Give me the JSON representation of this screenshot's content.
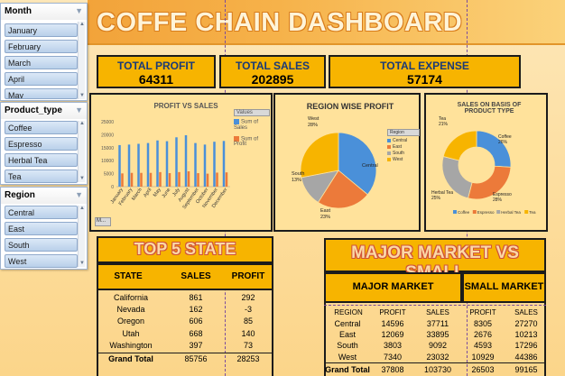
{
  "title": "COFFE CHAIN DASHBOARD",
  "slicers": {
    "month": {
      "label": "Month",
      "items": [
        "January",
        "February",
        "March",
        "April",
        "May"
      ]
    },
    "product_type": {
      "label": "Product_type",
      "items": [
        "Coffee",
        "Espresso",
        "Herbal Tea",
        "Tea"
      ]
    },
    "region": {
      "label": "Region",
      "items": [
        "Central",
        "East",
        "South",
        "West"
      ]
    }
  },
  "kpis": {
    "profit": {
      "label": "TOTAL PROFIT",
      "value": "64311"
    },
    "sales": {
      "label": "TOTAL SALES",
      "value": "202895"
    },
    "expense": {
      "label": "TOTAL EXPENSE",
      "value": "57174"
    }
  },
  "profit_vs_sales": {
    "title": "PROFIT VS SALES",
    "legend": {
      "label": "Values",
      "sales": "Sum of Sales",
      "profit": "Sum of Profit"
    },
    "field_button": "M...",
    "colors": {
      "sales": "#4a90d9",
      "profit": "#ec7a3a"
    }
  },
  "region_profit": {
    "title": "REGION WISE PROFIT",
    "legend_title": "Region",
    "labels": {
      "west": "West\n28%",
      "central": "Central",
      "south": "South\n13%",
      "east": "East\n23%"
    }
  },
  "product_sales": {
    "title": "SALES ON BASIS OF PRODUCT TYPE"
  },
  "chart_data": [
    {
      "type": "bar",
      "title": "PROFIT VS SALES",
      "categories": [
        "January",
        "February",
        "March",
        "April",
        "May",
        "June",
        "July",
        "August",
        "September",
        "October",
        "November",
        "December"
      ],
      "series": [
        {
          "name": "Sum of Sales",
          "values": [
            16000,
            16200,
            16500,
            16800,
            17800,
            17500,
            19000,
            19800,
            16800,
            16200,
            17300,
            17600
          ]
        },
        {
          "name": "Sum of Profit",
          "values": [
            5100,
            5300,
            5300,
            5300,
            5600,
            5200,
            5600,
            5900,
            5200,
            5000,
            5400,
            5500
          ]
        }
      ],
      "ylim": [
        0,
        25000
      ],
      "yticks": [
        0,
        5000,
        10000,
        15000,
        20000,
        25000
      ],
      "legend": "right"
    },
    {
      "type": "pie",
      "title": "REGION WISE PROFIT",
      "categories": [
        "Central",
        "East",
        "South",
        "West"
      ],
      "values": [
        36,
        23,
        13,
        28
      ],
      "colors": [
        "#4a90d9",
        "#ec7a3a",
        "#a6a6a6",
        "#f7b400"
      ],
      "legend": "right"
    },
    {
      "type": "pie",
      "title": "SALES ON BASIS OF PRODUCT TYPE",
      "categories": [
        "Coffee",
        "Espresso",
        "Herbal Tea",
        "Tea"
      ],
      "values": [
        26,
        28,
        25,
        21
      ],
      "colors": [
        "#4a90d9",
        "#ec7a3a",
        "#a6a6a6",
        "#f7b400"
      ],
      "legend": "bottom"
    }
  ],
  "top5": {
    "title": "TOP 5 STATE",
    "headers": [
      "STATE",
      "SALES",
      "PROFIT"
    ],
    "rows": [
      [
        "California",
        "861",
        "292"
      ],
      [
        "Nevada",
        "162",
        "-3"
      ],
      [
        "Oregon",
        "606",
        "85"
      ],
      [
        "Utah",
        "668",
        "140"
      ],
      [
        "Washington",
        "397",
        "73"
      ]
    ],
    "total": [
      "Grand Total",
      "85756",
      "28253"
    ]
  },
  "market": {
    "title": "MAJOR MARKET VS SMALL",
    "major": "MAJOR MARKET",
    "small": "SMALL MARKET",
    "headers": [
      "REGION",
      "PROFIT",
      "SALES",
      "PROFIT",
      "SALES"
    ],
    "rows": [
      [
        "Central",
        "14596",
        "37711",
        "8305",
        "27270"
      ],
      [
        "East",
        "12069",
        "33895",
        "2676",
        "10213"
      ],
      [
        "South",
        "3803",
        "9092",
        "4593",
        "17296"
      ],
      [
        "West",
        "7340",
        "23032",
        "10929",
        "44386"
      ]
    ],
    "total": [
      "Grand Total",
      "37808",
      "103730",
      "26503",
      "99165"
    ]
  }
}
